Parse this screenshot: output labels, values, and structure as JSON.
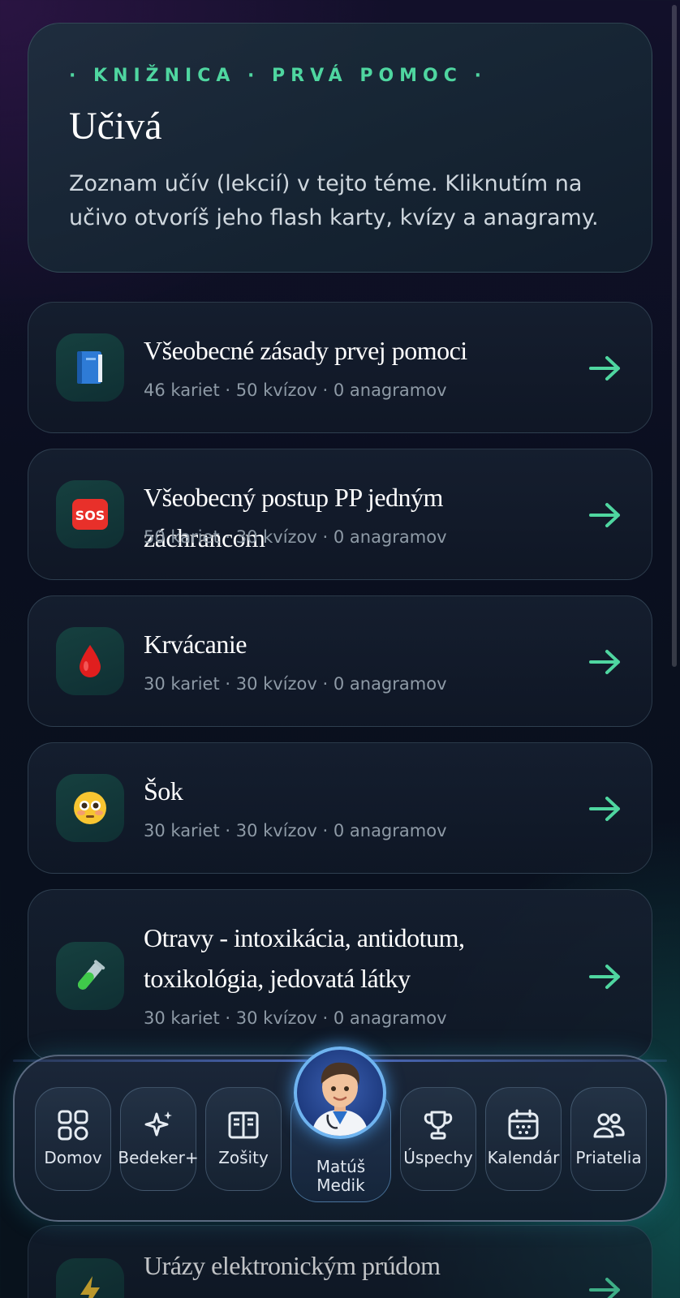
{
  "header": {
    "eyebrow": "· KNIŽNICA · PRVÁ POMOC ·",
    "title": "Učivá",
    "description": "Zoznam učív (lekcií) v tejto téme. Kliknutím na učivo otvoríš jeho flash karty, kvízy a anagramy."
  },
  "lessons": [
    {
      "title": "Všeobecné zásady prvej pomoci",
      "meta": "46 kariet · 50 kvízov · 0 anagramov",
      "icon": "blue-book-icon"
    },
    {
      "title": "Všeobecný postup PP jedným záchrancom",
      "meta": "50 kariet · 30 kvízov · 0 anagramov",
      "icon": "sos-icon"
    },
    {
      "title": "Krvácanie",
      "meta": "30 kariet · 30 kvízov · 0 anagramov",
      "icon": "blood-drop-icon"
    },
    {
      "title": "Šok",
      "meta": "30 kariet · 30 kvízov · 0 anagramov",
      "icon": "flushed-face-icon"
    },
    {
      "title": "Otravy - intoxikácia, antidotum, toxikológia, jedovatá látky",
      "meta": "30 kariet · 30 kvízov · 0 anagramov",
      "icon": "test-tube-icon"
    },
    {
      "title": "Urázy elektronickým prúdom",
      "meta": "",
      "icon": "lightning-icon"
    }
  ],
  "nav": {
    "home": "Domov",
    "bedeker": "Bedeker+",
    "notebooks": "Zošity",
    "profile_first": "Matúš",
    "profile_last": "Medik",
    "achievements": "Úspechy",
    "calendar": "Kalendár",
    "friends": "Priatelia"
  },
  "colors": {
    "accent": "#4fd6a0",
    "avatar_ring": "#6fb4f0"
  }
}
